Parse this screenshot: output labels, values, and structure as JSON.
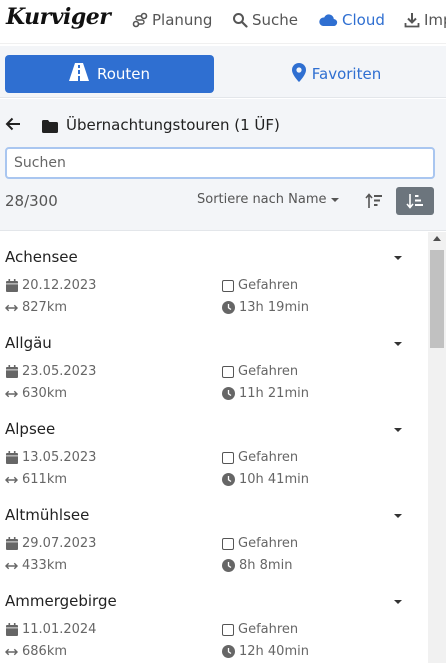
{
  "app": {
    "logo_text": "Kurviger"
  },
  "nav": {
    "items": [
      {
        "label": "Planung",
        "icon": "route-planning-icon"
      },
      {
        "label": "Suche",
        "icon": "search-icon"
      },
      {
        "label": "Cloud",
        "icon": "cloud-icon",
        "active": true
      },
      {
        "label": "Imp",
        "icon": "download-icon"
      }
    ]
  },
  "tabs": {
    "routes_label": "Routen",
    "favorites_label": "Favoriten"
  },
  "folder": {
    "title": "Übernachtungstouren (1 ÜF)",
    "search_placeholder": "Suchen",
    "search_value": "",
    "count": "28/300",
    "sort_label": "Sortiere nach Name"
  },
  "routes": [
    {
      "name": "Achensee",
      "date": "20.12.2023",
      "distance": "827km",
      "driven_label": "Gefahren",
      "duration": "13h 19min"
    },
    {
      "name": "Allgäu",
      "date": "23.05.2023",
      "distance": "630km",
      "driven_label": "Gefahren",
      "duration": "11h 21min"
    },
    {
      "name": "Alpsee",
      "date": "13.05.2023",
      "distance": "611km",
      "driven_label": "Gefahren",
      "duration": "10h 41min"
    },
    {
      "name": "Altmühlsee",
      "date": "29.07.2023",
      "distance": "433km",
      "driven_label": "Gefahren",
      "duration": "8h 8min"
    },
    {
      "name": "Ammergebirge",
      "date": "11.01.2024",
      "distance": "686km",
      "driven_label": "Gefahren",
      "duration": "12h 40min"
    }
  ],
  "colors": {
    "accent": "#2f6fd1",
    "panel": "#f3f5f8",
    "sort_button": "#6c757d"
  }
}
